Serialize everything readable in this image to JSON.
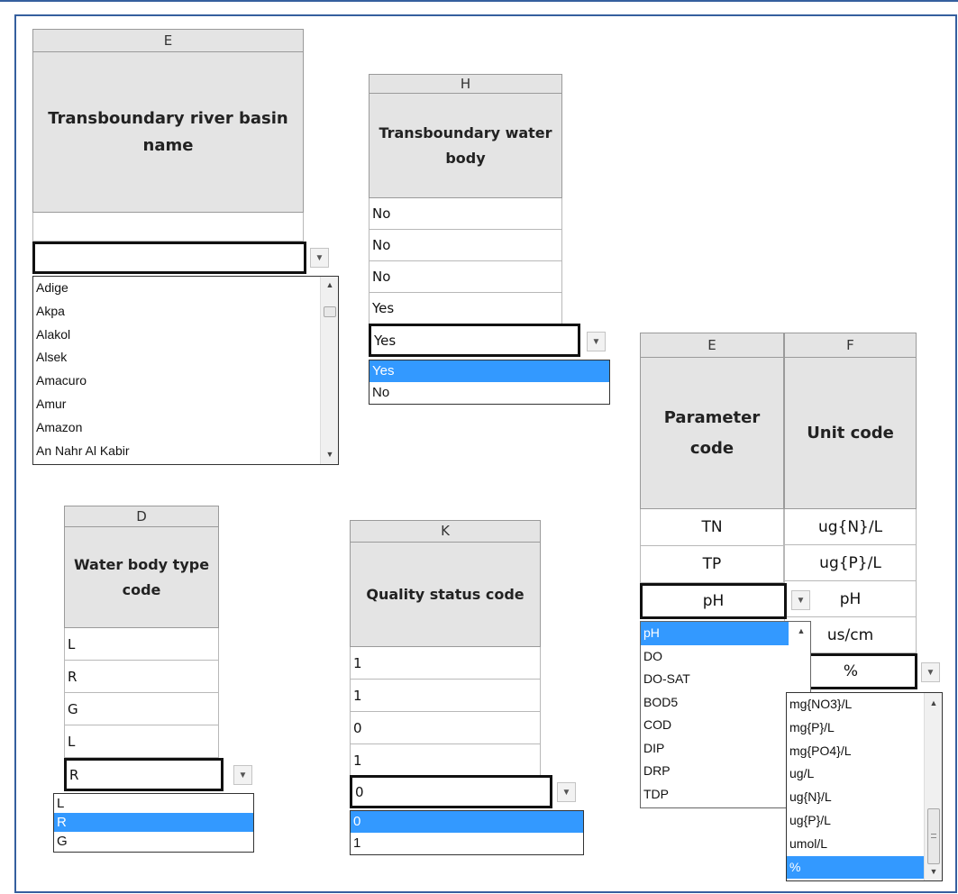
{
  "panels": {
    "basin": {
      "column_letter": "E",
      "header": "Transboundary river basin name",
      "active_value": "",
      "options": [
        "Adige",
        "Akpa",
        "Alakol",
        "Alsek",
        "Amacuro",
        "Amur",
        "Amazon",
        "An Nahr Al Kabir"
      ]
    },
    "water_body": {
      "column_letter": "H",
      "header": "Transboundary water body",
      "cells": [
        "No",
        "No",
        "No",
        "Yes"
      ],
      "active_value": "Yes",
      "options": [
        "Yes",
        "No"
      ],
      "selected_option": "Yes"
    },
    "type_code": {
      "column_letter": "D",
      "header": "Water body type code",
      "cells": [
        "L",
        "R",
        "G",
        "L"
      ],
      "active_value": "R",
      "options": [
        "L",
        "R",
        "G"
      ],
      "selected_option": "R"
    },
    "quality": {
      "column_letter": "K",
      "header": "Quality status code",
      "cells": [
        "1",
        "1",
        "0",
        "1"
      ],
      "active_value": "0",
      "options": [
        "0",
        "1"
      ],
      "selected_option": "0"
    },
    "param_unit": {
      "param_column_letter": "E",
      "unit_column_letter": "F",
      "param_header": "Parameter code",
      "unit_header": "Unit code",
      "param_cells": [
        "TN",
        "TP"
      ],
      "unit_cells": [
        "ug{N}/L",
        "ug{P}/L",
        "pH",
        "us/cm"
      ],
      "param_active_value": "pH",
      "unit_active_value": "%",
      "param_options": [
        "pH",
        "DO",
        "DO-SAT",
        "BOD5",
        "COD",
        "DIP",
        "DRP",
        "TDP"
      ],
      "param_selected_option": "pH",
      "unit_options": [
        "mg{NO3}/L",
        "mg{P}/L",
        "mg{PO4}/L",
        "ug/L",
        "ug{N}/L",
        "ug{P}/L",
        "umol/L",
        "%"
      ],
      "unit_selected_option": "%"
    }
  },
  "icons": {
    "dropdown_arrow": "triangle-down",
    "scroll_up": "triangle-up",
    "scroll_down": "triangle-down"
  },
  "colors": {
    "frame_border": "#355f9e",
    "header_bg": "#e4e4e4",
    "selection": "#3399ff"
  }
}
